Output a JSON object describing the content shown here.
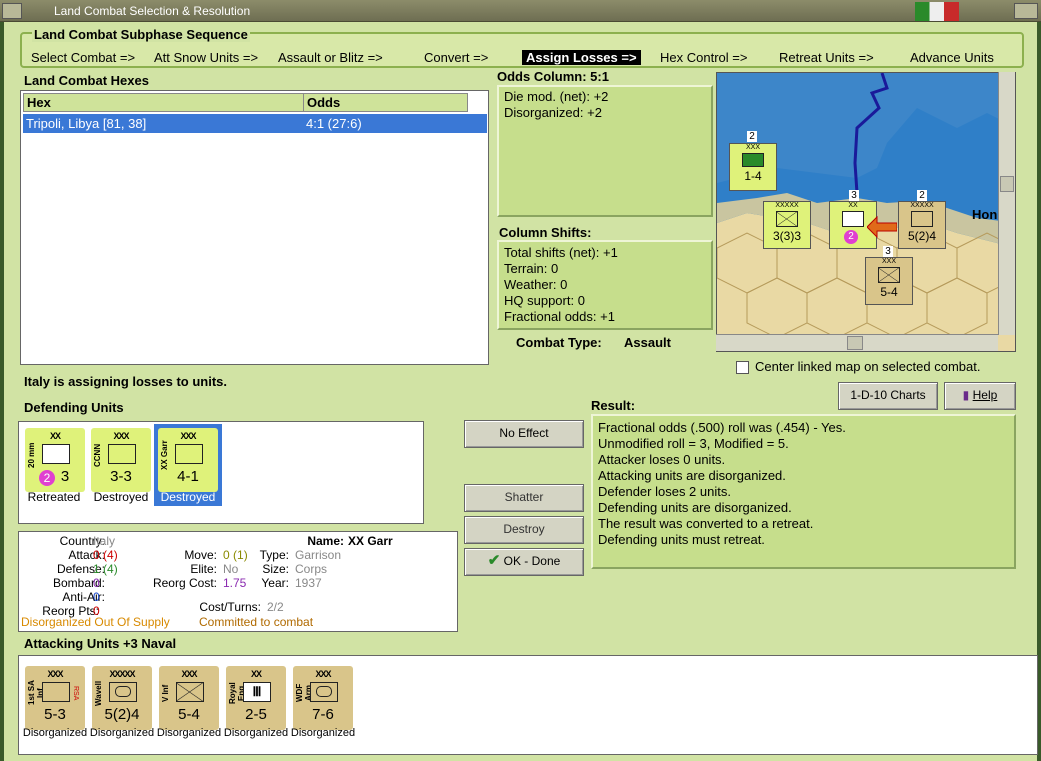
{
  "window": {
    "title": "Land Combat Selection & Resolution"
  },
  "phases": {
    "title": "Land Combat Subphase Sequence",
    "items": [
      "Select Combat =>",
      "Att Snow Units =>",
      "Assault or Blitz =>",
      "Convert =>",
      "Assign Losses =>",
      "Hex Control =>",
      "Retreat Units =>",
      "Advance Units"
    ],
    "active": "Assign Losses =>"
  },
  "hexes": {
    "title": "Land Combat Hexes",
    "col_hex": "Hex",
    "col_odds": "Odds",
    "rows": [
      {
        "hex": "Tripoli, Libya [81, 38]",
        "odds": "4:1 (27:6)"
      }
    ]
  },
  "odds": {
    "title": "Odds Column: 5:1",
    "lines": [
      "Die mod. (net): +2",
      "Disorganized: +2"
    ]
  },
  "shifts": {
    "title": "Column Shifts:",
    "lines": [
      "Total shifts (net): +1",
      "Terrain: 0",
      "Weather: 0",
      "HQ support: 0",
      "Fractional odds: +1"
    ]
  },
  "combat_type": {
    "label": "Combat Type:",
    "value": "Assault"
  },
  "map": {
    "center_label": "Center linked map on selected combat.",
    "town_label": "Hon",
    "counters": [
      {
        "size": "XXX",
        "value": "1-4",
        "stack": "2"
      },
      {
        "size": "XXXXX",
        "value": "3(3)3"
      },
      {
        "size": "XX",
        "value": "",
        "stack": "3",
        "badge": "2"
      },
      {
        "size": "XXXXX",
        "value": "5(2)4",
        "stack": "2"
      },
      {
        "size": "XXX",
        "value": "5-4",
        "stack": "3"
      }
    ]
  },
  "status": "Italy is assigning losses to units.",
  "defending": {
    "title": "Defending Units",
    "units": [
      {
        "size": "XX",
        "name": "20 mm",
        "value": "3",
        "badge": "2",
        "status": "Retreated",
        "selected": false
      },
      {
        "size": "XXX",
        "name": "CCNN",
        "value": "3-3",
        "status": "Destroyed",
        "selected": false
      },
      {
        "size": "XXX",
        "name": "XX Garr",
        "value": "4-1",
        "status": "Destroyed",
        "selected": true
      }
    ]
  },
  "buttons": {
    "no_effect": "No Effect",
    "shatter": "Shatter",
    "destroy": "Destroy",
    "ok_done": "OK - Done",
    "charts": "1-D-10 Charts",
    "help": "Help"
  },
  "result": {
    "title": "Result:",
    "lines": [
      "Fractional odds (.500) roll was (.454)  - Yes.",
      "Unmodified roll = 3, Modified = 5.",
      "Attacker loses 0 units.",
      "Attacking units are disorganized.",
      "Defender loses 2 units.",
      "Defending units are disorganized.",
      "The result was converted to a retreat.",
      "Defending units must retreat."
    ]
  },
  "unit_info": {
    "country_k": "Country:",
    "country_v": "Italy",
    "attack_k": "Attack:",
    "attack_v": "0",
    "attack_p": "(4)",
    "defense_k": "Defense:",
    "defense_v": "1",
    "defense_p": "(4)",
    "bombard_k": "Bombard:",
    "bombard_v": "0",
    "antiair_k": "Anti-Air:",
    "antiair_v": "0",
    "reorgpts_k": "Reorg Pts:",
    "reorgpts_v": "0",
    "name_k": "Name:",
    "name_v": "XX Garr",
    "move_k": "Move:",
    "move_v": "0",
    "move_p": "(1)",
    "elite_k": "Elite:",
    "elite_v": "No",
    "reorgcost_k": "Reorg Cost:",
    "reorgcost_v": "1.75",
    "costturns_k": "Cost/Turns:",
    "costturns_v": "2/2",
    "type_k": "Type:",
    "type_v": "Garrison",
    "size_k": "Size:",
    "size_v": "Corps",
    "year_k": "Year:",
    "year_v": "1937",
    "status1": "Disorganized Out Of Supply",
    "status2": "Committed to combat"
  },
  "attacking": {
    "title": "Attacking Units +3 Naval",
    "units": [
      {
        "size": "XXX",
        "name": "1st SA Inf",
        "value": "5-3",
        "tag": "RSA",
        "status": "Disorganized"
      },
      {
        "size": "XXXXX",
        "name": "Wavell",
        "value": "5(2)4",
        "status": "Disorganized"
      },
      {
        "size": "XXX",
        "name": "V Inf",
        "value": "5-4",
        "status": "Disorganized"
      },
      {
        "size": "XX",
        "name": "Royal Eng",
        "value": "2-5",
        "status": "Disorganized"
      },
      {
        "size": "XXX",
        "name": "WDF Arm",
        "value": "7-6",
        "status": "Disorganized"
      }
    ]
  },
  "colors": {
    "panel": "#d1e3a4",
    "selection": "#3a78d6",
    "red": "#cc0000",
    "green": "#2a8a2a",
    "purple": "#8a2ab0",
    "orange": "#d88a00",
    "grey": "#888888"
  }
}
